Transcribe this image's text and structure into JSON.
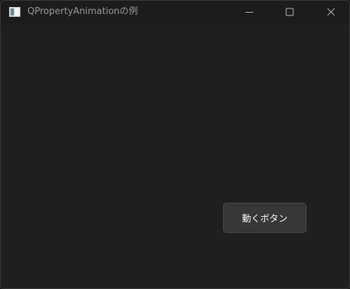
{
  "window": {
    "title": "QPropertyAnimationの例",
    "controls": {
      "minimize_icon": "minimize-icon",
      "maximize_icon": "maximize-icon",
      "close_icon": "close-icon"
    }
  },
  "content": {
    "move_button_label": "動くボタン"
  },
  "colors": {
    "background": "#1f1f1f",
    "titlebar": "#1c1c1c",
    "button": "#373737",
    "title_text": "#9a9a9a"
  }
}
